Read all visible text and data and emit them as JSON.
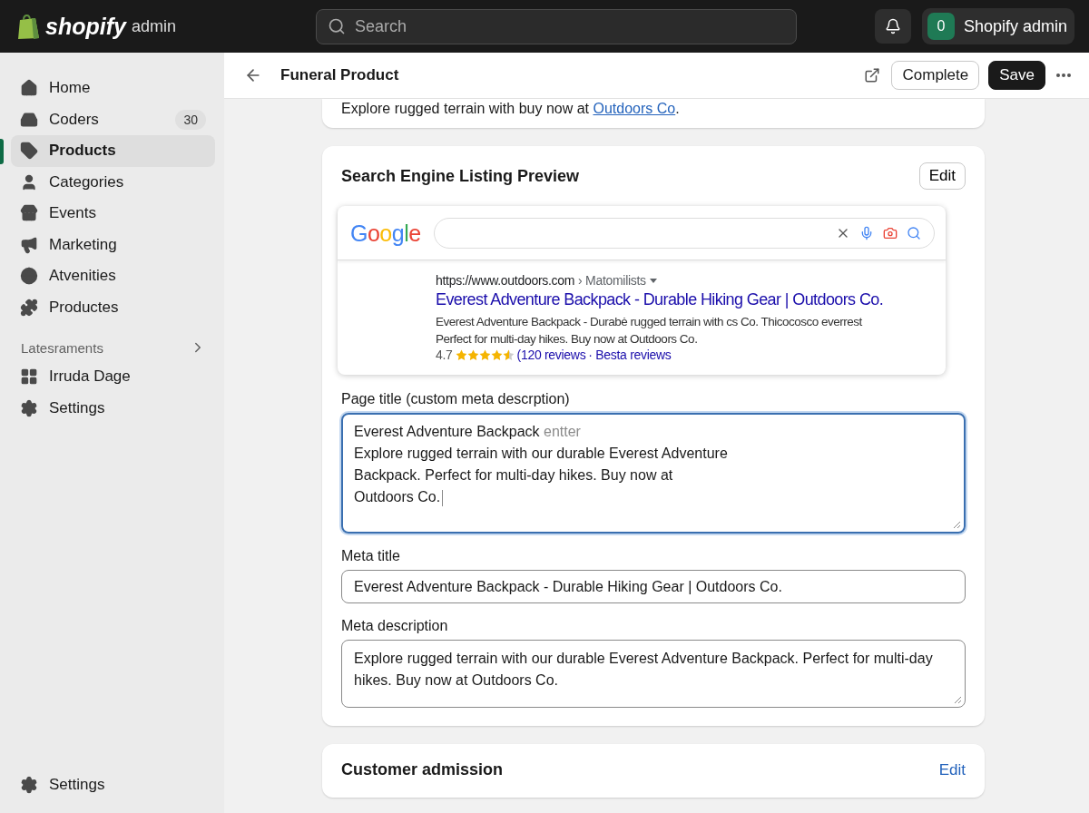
{
  "topbar": {
    "brand": "shopify",
    "brand_suffix": "admin",
    "search": {
      "placeholder": "Search"
    },
    "store": {
      "initial": "0",
      "name": "Shopify admin"
    }
  },
  "sidebar": {
    "items": [
      {
        "label": "Home",
        "selected": false
      },
      {
        "label": "Coders",
        "badge": "30",
        "selected": false
      },
      {
        "label": "Products",
        "selected": true
      },
      {
        "label": "Categories",
        "selected": false
      },
      {
        "label": "Events",
        "selected": false
      },
      {
        "label": "Marketing",
        "selected": false
      },
      {
        "label": "Atvenities",
        "selected": false
      },
      {
        "label": "Productes",
        "selected": false
      }
    ],
    "section": {
      "title": "Latesraments",
      "items": [
        {
          "label": "Irruda Dage",
          "selected": false
        },
        {
          "label": "Settings",
          "selected": false
        }
      ]
    },
    "footer": {
      "label": "Settings"
    }
  },
  "page_header": {
    "title": "Funeral Product",
    "buttons": [
      "Complete",
      "Save"
    ]
  },
  "top_card": {
    "text": "Explore rugged terrain with buy now at ",
    "link": "Outdoors Co",
    "end": "."
  },
  "seo_card": {
    "title": "Search Engine Listing Preview",
    "edit": "Edit",
    "preview": {
      "logo": "Google",
      "url": "https://www.outdoors.com",
      "breadcrumb": "› Matomilists",
      "title": "Everest Adventure Backpack - Durable Hiking Gear | Outdoors Co.",
      "description": "Everest Adventure Backpack - Durabė rugged terrain with cs Co. Thicocosco everrest Perfect for multi-day hikes. Buy now at Outdoors Co.",
      "rating": "4.7",
      "stars": 4.5,
      "reviews": "(120 reviews",
      "more": "· Besta reviews"
    },
    "fields": [
      {
        "label": "Page title (custom meta descrption)",
        "kind": "textarea",
        "focused": true,
        "value": "Everest Adventure Backpack",
        "suggestion": "entter",
        "body": "Explore rugged terrain with our durable Everest Adventure\nBackpack. Perfect for multi-day hikes. Buy now at\nOutdoors Co."
      },
      {
        "label": "Meta title",
        "kind": "input",
        "value": "Everest Adventure Backpack - Durable Hiking Gear | Outdoors Co."
      },
      {
        "label": "Meta description",
        "kind": "textarea",
        "value": "Explore rugged terrain with our durable Everest Adventure Backpack. Perfect for multi-day hikes. Buy now at Outdoors Co."
      }
    ]
  },
  "bottom_card": {
    "title": "Customer admission",
    "edit": "Edit"
  }
}
